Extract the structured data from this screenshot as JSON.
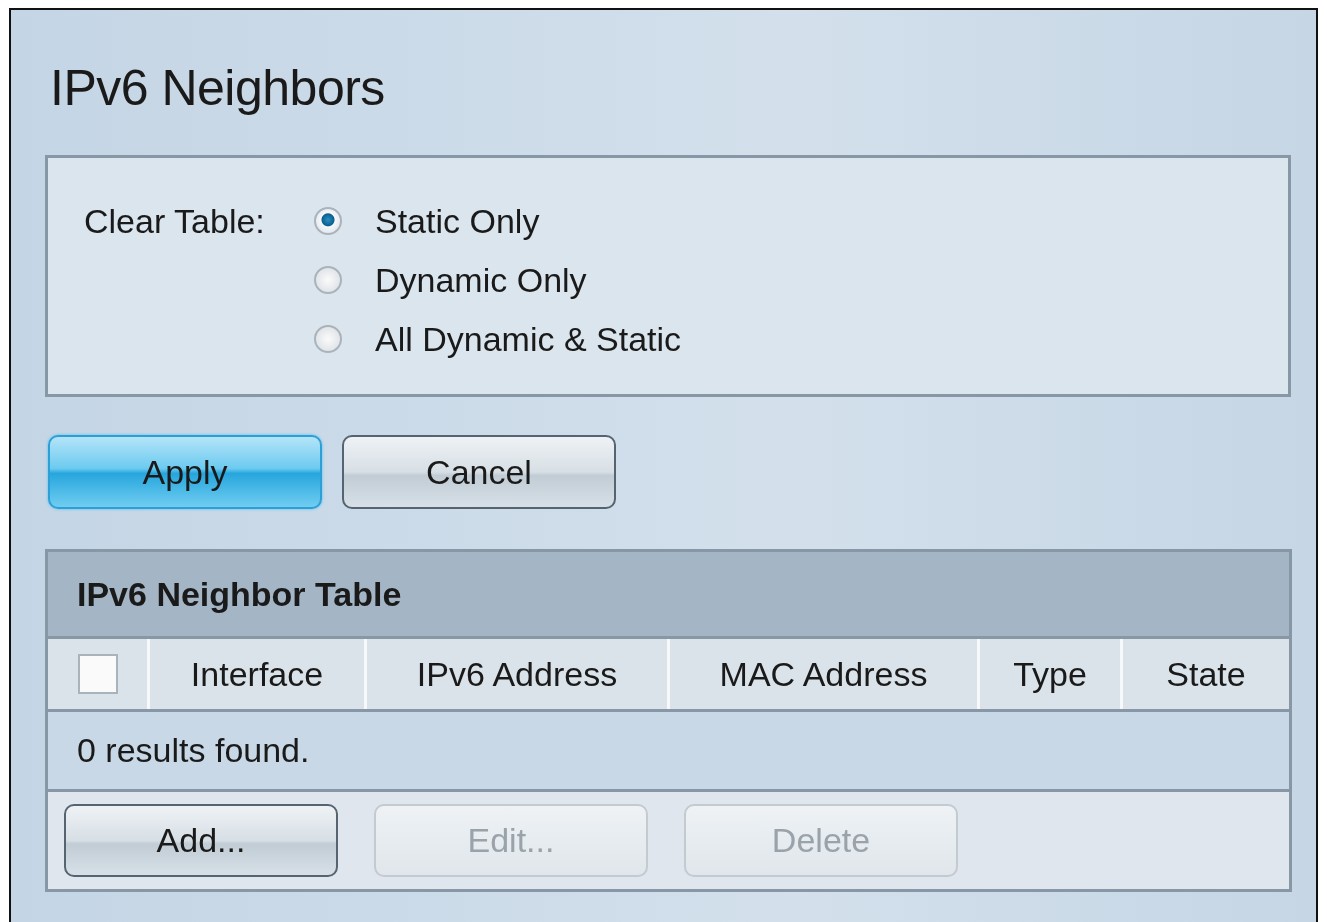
{
  "page": {
    "title": "IPv6 Neighbors"
  },
  "clear_table": {
    "label": "Clear Table:",
    "options": [
      {
        "label": "Static Only",
        "selected": true
      },
      {
        "label": "Dynamic Only",
        "selected": false
      },
      {
        "label": "All Dynamic & Static",
        "selected": false
      }
    ]
  },
  "actions": [
    {
      "label": "Apply",
      "kind": "primary"
    },
    {
      "label": "Cancel",
      "kind": "normal"
    }
  ],
  "table": {
    "title": "IPv6 Neighbor Table",
    "select_all": {
      "checked": false
    },
    "columns": [
      "Interface",
      "IPv6 Address",
      "MAC Address",
      "Type",
      "State"
    ],
    "message": "0 results found.",
    "buttons": [
      {
        "label": "Add...",
        "disabled": false
      },
      {
        "label": "Edit...",
        "disabled": true
      },
      {
        "label": "Delete",
        "disabled": true
      }
    ]
  }
}
